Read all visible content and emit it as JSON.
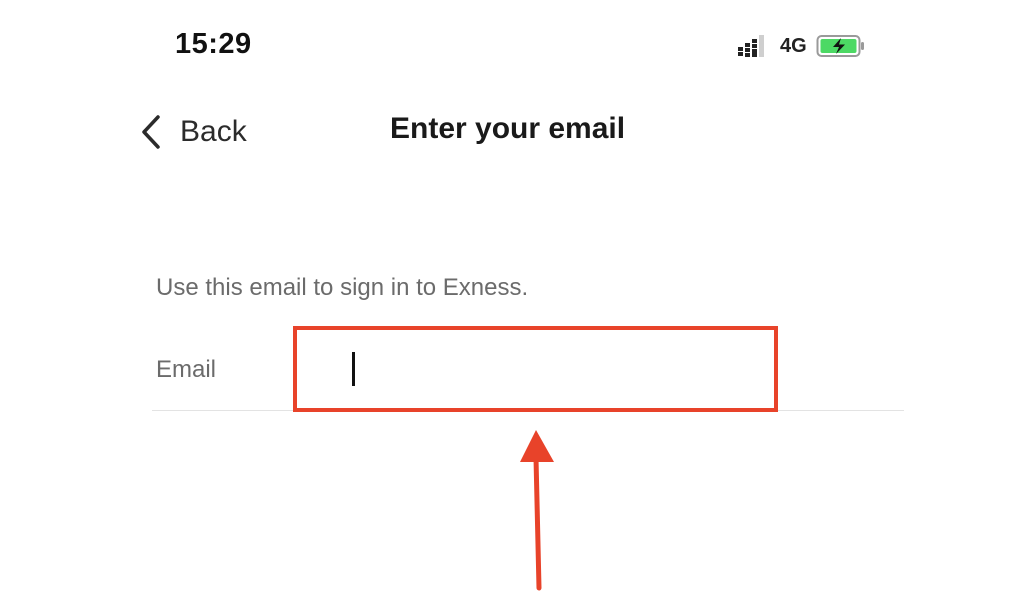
{
  "status_bar": {
    "time": "15:29",
    "network": "4G",
    "signal_icon": "signal-bars-icon",
    "battery_icon": "battery-charging-icon",
    "battery_color": "#4cd964"
  },
  "nav": {
    "back_label": "Back",
    "back_icon": "chevron-left-icon",
    "title": "Enter your email"
  },
  "form": {
    "hint": "Use this email to sign in to Exness.",
    "email_label": "Email",
    "email_value": "",
    "email_placeholder": ""
  },
  "colors": {
    "annotation": "#e8432a",
    "label_text": "#6b6b6b",
    "divider": "#e3e3e3"
  }
}
